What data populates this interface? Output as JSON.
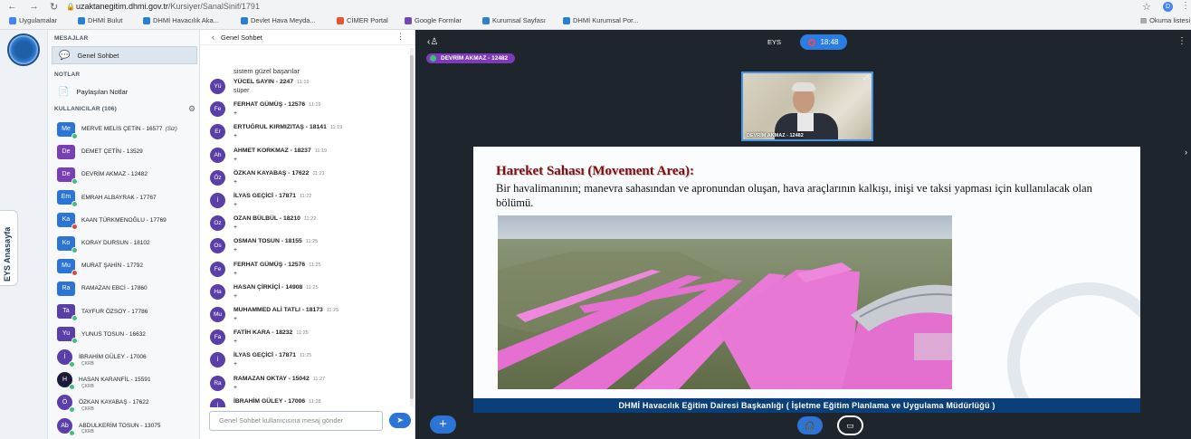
{
  "browser": {
    "url_host": "uzaktanegitim.dhmi.gov.tr",
    "url_path": "/Kursiyer/SanalSinif/1791",
    "profile_initial": "D",
    "bookmarks": [
      {
        "label": "Uygulamalar",
        "color": "#4285f4"
      },
      {
        "label": "DHMİ Bulut",
        "color": "#2a7fd3"
      },
      {
        "label": "DHMİ Havacılık Aka...",
        "color": "#2a7fd3"
      },
      {
        "label": "Devlet Hava Meyda...",
        "color": "#2a7fd3"
      },
      {
        "label": "CİMER Portal",
        "color": "#e8542b"
      },
      {
        "label": "Google Formlar",
        "color": "#7248b9"
      },
      {
        "label": "Kurumsal Sayfası",
        "color": "#2a7fd3"
      },
      {
        "label": "DHMİ Kurumsal Por...",
        "color": "#2a7fd3"
      }
    ],
    "reading_list": "Okuma listesi"
  },
  "rail": {
    "eys_tab": "EYS Anasayfa"
  },
  "side": {
    "messages_title": "MESAJLAR",
    "genel_sohbet": "Genel Sohbet",
    "notes_title": "NOTLAR",
    "shared_notes": "Paylaşılan Notlar",
    "users_title": "KULLANICILAR (106)",
    "users": [
      {
        "initials": "Me",
        "name": "MERVE MELİS ÇETİN - 16577",
        "you": "(Siz)",
        "color": "#2c74d6",
        "status": "#3fbf7a",
        "round": false
      },
      {
        "initials": "De",
        "name": "DEMET ÇETİN - 13529",
        "color": "#7a3fb5",
        "status": "",
        "round": false
      },
      {
        "initials": "De",
        "name": "DEVRİM AKMAZ - 12482",
        "color": "#7a3fb5",
        "status": "#3fbf7a",
        "round": false
      },
      {
        "initials": "Em",
        "name": "EMRAH ALBAYRAK - 17767",
        "color": "#2c74d6",
        "status": "#3fbf7a",
        "round": false
      },
      {
        "initials": "Ka",
        "name": "KAAN TÜRKMENOĞLU - 17769",
        "color": "#2c74d6",
        "status": "#e0463a",
        "round": false
      },
      {
        "initials": "Ko",
        "name": "KORAY DURSUN - 18102",
        "color": "#2c74d6",
        "status": "#3fbf7a",
        "round": false
      },
      {
        "initials": "Mu",
        "name": "MURAT ŞAHİN - 17792",
        "color": "#2c74d6",
        "status": "#e0463a",
        "round": false
      },
      {
        "initials": "Ra",
        "name": "RAMAZAN EBCİ - 17860",
        "color": "#2c74d6",
        "status": "",
        "round": false
      },
      {
        "initials": "Ta",
        "name": "TAYFUR ÖZSOY - 17786",
        "color": "#5a3fa8",
        "status": "#3fbf7a",
        "round": false
      },
      {
        "initials": "Yu",
        "name": "YUNUS TOSUN - 16632",
        "color": "#5a3fa8",
        "status": "#3fbf7a",
        "round": false
      },
      {
        "initials": "İ",
        "name": "İBRAHİM GÜLEY - 17006",
        "sub": "ÇKRB",
        "color": "#5a3fa8",
        "status": "#3fbf7a",
        "round": true
      },
      {
        "initials": "H",
        "name": "HASAN KARANFİL - 15591",
        "sub": "ÇKRB",
        "color": "#1b1b3a",
        "status": "#3fbf7a",
        "round": true
      },
      {
        "initials": "Ö",
        "name": "ÖZKAN KAYABAŞ - 17622",
        "sub": "ÇKRB",
        "color": "#5a3fa8",
        "status": "#3fbf7a",
        "round": true
      },
      {
        "initials": "Ab",
        "name": "ABDULKERİM TOSUN - 13075",
        "sub": "ÇKRB",
        "color": "#5a3fa8",
        "status": "#3fbf7a",
        "round": true
      }
    ]
  },
  "chat": {
    "title": "Genel Sohbet",
    "first_line": "sistem güzel başarılar",
    "messages": [
      {
        "initials": "Yü",
        "name": "YÜCEL SAYIN - 2247",
        "time": "11:19",
        "text": "süper"
      },
      {
        "initials": "Fe",
        "name": "FERHAT GÜMÜŞ - 12576",
        "time": "11:19",
        "text": "+"
      },
      {
        "initials": "Er",
        "name": "ERTUĞRUL KIRMIZITAŞ - 18141",
        "time": "11:19",
        "text": "+"
      },
      {
        "initials": "Ah",
        "name": "AHMET KORKMAZ - 18237",
        "time": "11:19",
        "text": "+"
      },
      {
        "initials": "Öz",
        "name": "ÖZKAN KAYABAŞ - 17622",
        "time": "11:21",
        "text": "+"
      },
      {
        "initials": "İ",
        "name": "İLYAS GEÇİCİ - 17871",
        "time": "11:22",
        "text": "+"
      },
      {
        "initials": "Oz",
        "name": "OZAN BÜLBÜL - 18210",
        "time": "11:22",
        "text": "+"
      },
      {
        "initials": "Os",
        "name": "OSMAN TOSUN - 18155",
        "time": "11:25",
        "text": "+"
      },
      {
        "initials": "Fe",
        "name": "FERHAT GÜMÜŞ - 12576",
        "time": "11:25",
        "text": "+"
      },
      {
        "initials": "Ha",
        "name": "HASAN ÇİRKİÇİ - 14908",
        "time": "11:25",
        "text": "+"
      },
      {
        "initials": "Mu",
        "name": "MUHAMMED ALİ TATLI - 18173",
        "time": "11:25",
        "text": "+"
      },
      {
        "initials": "Fa",
        "name": "FATİH KARA - 18232",
        "time": "11:25",
        "text": "+"
      },
      {
        "initials": "İ",
        "name": "İLYAS GEÇİCİ - 17871",
        "time": "11:25",
        "text": "+"
      },
      {
        "initials": "Ra",
        "name": "RAMAZAN OKTAY - 15042",
        "time": "11:27",
        "text": "+"
      },
      {
        "initials": "İ",
        "name": "İBRAHİM GÜLEY - 17006",
        "time": "11:28",
        "text": "+"
      }
    ],
    "input_placeholder": "Genel Sohbet kullanıcısına mesaj gönder"
  },
  "meeting": {
    "eys_label": "EYS",
    "timer": "18:48",
    "presenter": "DEVRİM AKMAZ - 12482",
    "webcam_label": "DEVRİM AKMAZ - 12482",
    "slide": {
      "title": "Hareket Sahası (Movement Area):",
      "body": "Bir havalimanının; manevra sahasından ve apronundan oluşan, hava araçlarının kalkışı, inişi ve taksi yapması için kullanılacak olan bölümü.",
      "footer": "DHMİ Havacılık Eğitim Dairesi Başkanlığı ( İşletme Eğitim Planlama ve Uygulama Müdürlüğü )"
    }
  }
}
